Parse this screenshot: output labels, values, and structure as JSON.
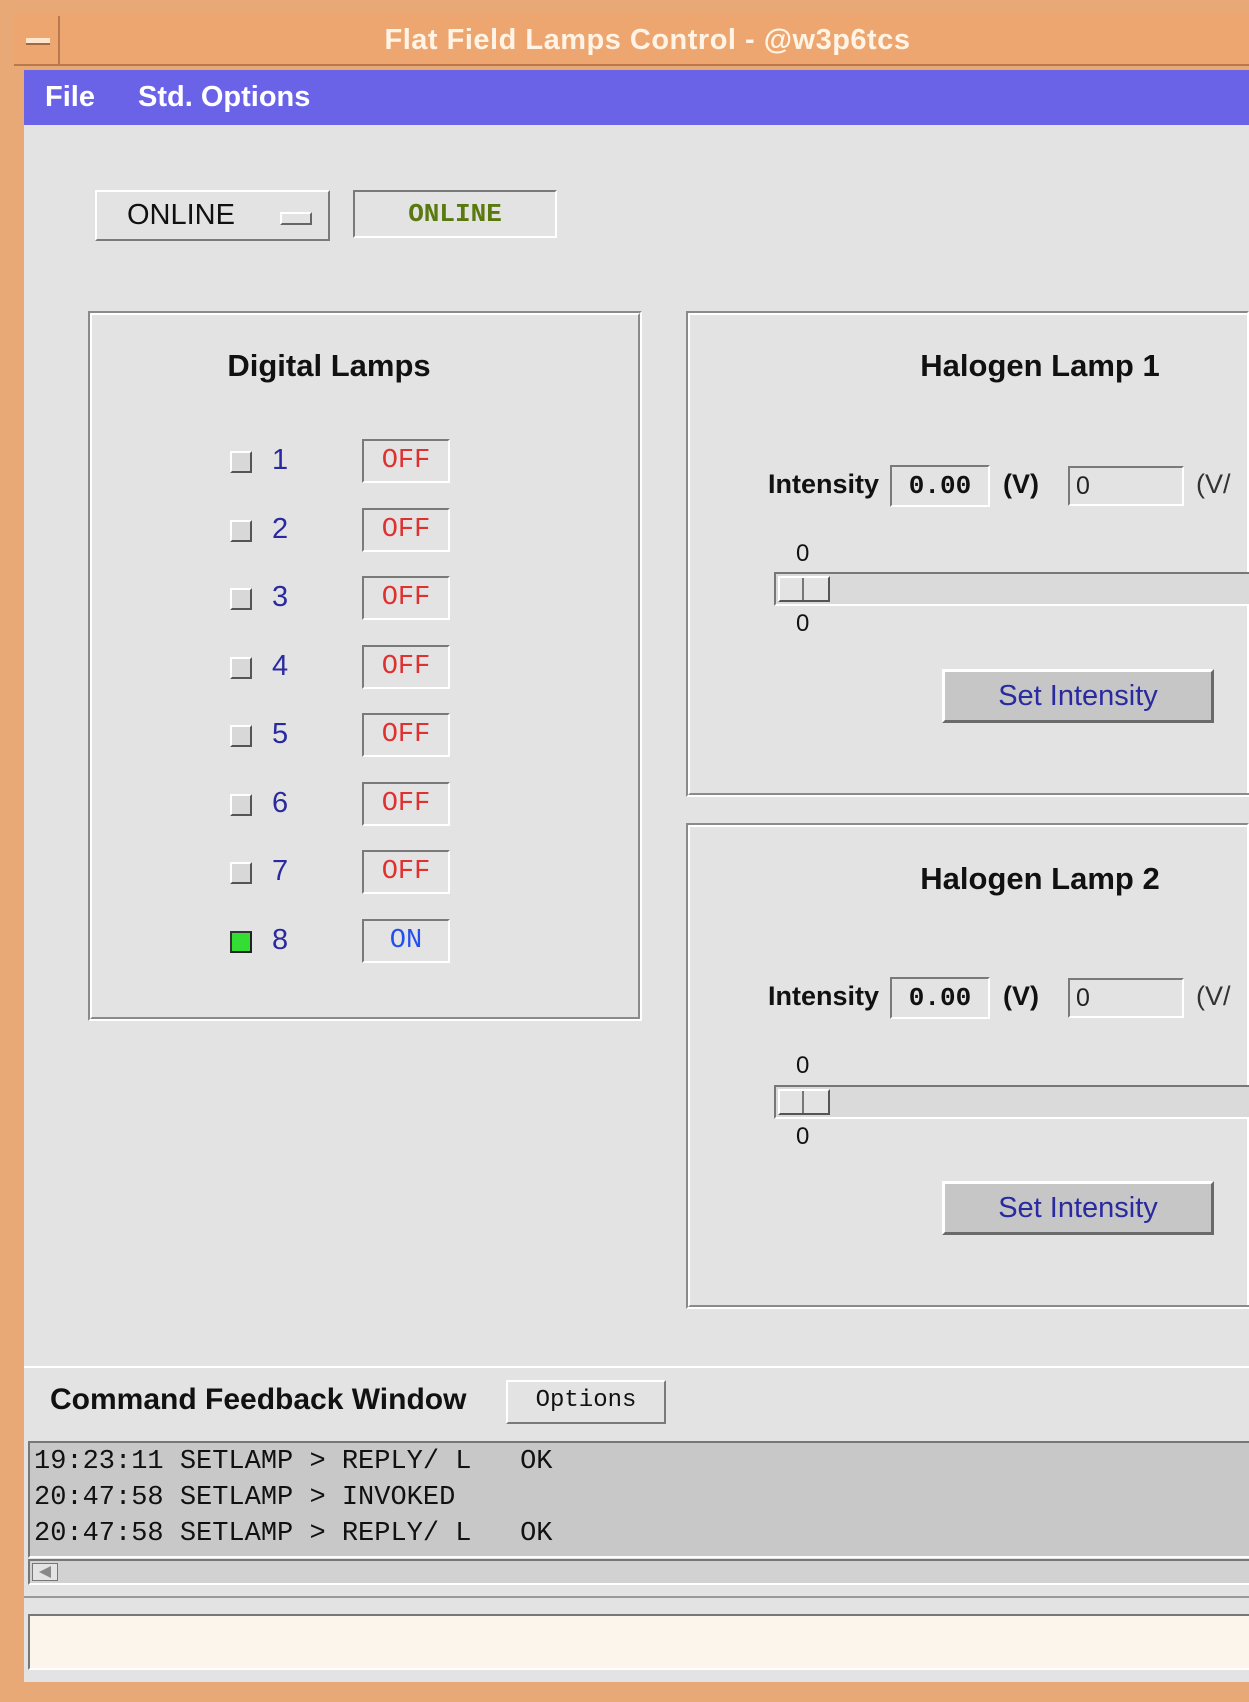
{
  "window": {
    "title": "Flat Field Lamps Control - @w3p6tcs"
  },
  "menubar": {
    "items": [
      "File",
      "Std. Options"
    ]
  },
  "mode": {
    "selected": "ONLINE",
    "status": "ONLINE"
  },
  "digital_lamps": {
    "title": "Digital Lamps",
    "lamps": [
      {
        "number": "1",
        "state": "OFF",
        "checked": false
      },
      {
        "number": "2",
        "state": "OFF",
        "checked": false
      },
      {
        "number": "3",
        "state": "OFF",
        "checked": false
      },
      {
        "number": "4",
        "state": "OFF",
        "checked": false
      },
      {
        "number": "5",
        "state": "OFF",
        "checked": false
      },
      {
        "number": "6",
        "state": "OFF",
        "checked": false
      },
      {
        "number": "7",
        "state": "OFF",
        "checked": false
      },
      {
        "number": "8",
        "state": "ON",
        "checked": true
      }
    ]
  },
  "halogen1": {
    "title": "Halogen Lamp 1",
    "intensity_label": "Intensity",
    "value": "0.00",
    "unit": "(V)",
    "input": "0",
    "input_unit": "(V/",
    "slider_value": "0",
    "slider_min": "0",
    "button": "Set Intensity"
  },
  "halogen2": {
    "title": "Halogen Lamp 2",
    "intensity_label": "Intensity",
    "value": "0.00",
    "unit": "(V)",
    "input": "0",
    "input_unit": "(V/",
    "slider_value": "0",
    "slider_min": "0",
    "button": "Set Intensity"
  },
  "feedback": {
    "title": "Command Feedback Window",
    "options_button": "Options",
    "lines": [
      "19:23:11 SETLAMP > REPLY/ L   OK",
      "20:47:58 SETLAMP > INVOKED",
      "20:47:58 SETLAMP > REPLY/ L   OK"
    ],
    "command_input": ""
  },
  "colors": {
    "titlebar": "#eea670",
    "menubar": "#6a63e8",
    "off": "#e03030",
    "on": "#2250ee",
    "status_online": "#5a7a10",
    "lamp_on_indicator": "#33dd33"
  }
}
